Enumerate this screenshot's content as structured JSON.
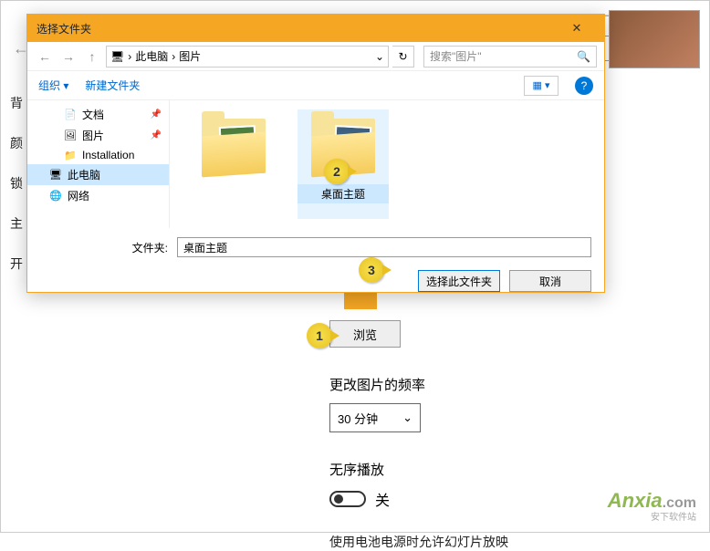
{
  "settings": {
    "win_min": "—",
    "win_max": "☐",
    "win_close": "✕",
    "sidebar": [
      "背",
      "颜",
      "锁",
      "主",
      "开"
    ],
    "browse_btn": "浏览",
    "freq_label": "更改图片的频率",
    "freq_value": "30 分钟",
    "shuffle_label": "无序播放",
    "shuffle_state": "关",
    "cut_text": "使用电池电源时允许幻灯片放映"
  },
  "dialog": {
    "title": "选择文件夹",
    "close": "✕",
    "breadcrumb": {
      "icon": "🖥",
      "pc": "此电脑",
      "folder": "图片",
      "sep": "›",
      "dd": "⌄"
    },
    "refresh": "↻",
    "search_placeholder": "搜索\"图片\"",
    "search_icon": "🔍",
    "organize": "组织 ▾",
    "newfolder": "新建文件夹",
    "view_icon": "▦ ▾",
    "help": "?",
    "tree": {
      "docs": "文档",
      "pics": "图片",
      "install": "Installation",
      "thispc": "此电脑",
      "network": "网络"
    },
    "folder1": "",
    "folder2": "桌面主题",
    "file_label": "文件夹:",
    "file_value": "桌面主题",
    "ok": "选择此文件夹",
    "cancel": "取消"
  },
  "annotations": {
    "a1": "1",
    "a2": "2",
    "a3": "3"
  },
  "watermark": {
    "brand": "Anxia",
    "dom": ".com",
    "sub": "安下软件站"
  }
}
